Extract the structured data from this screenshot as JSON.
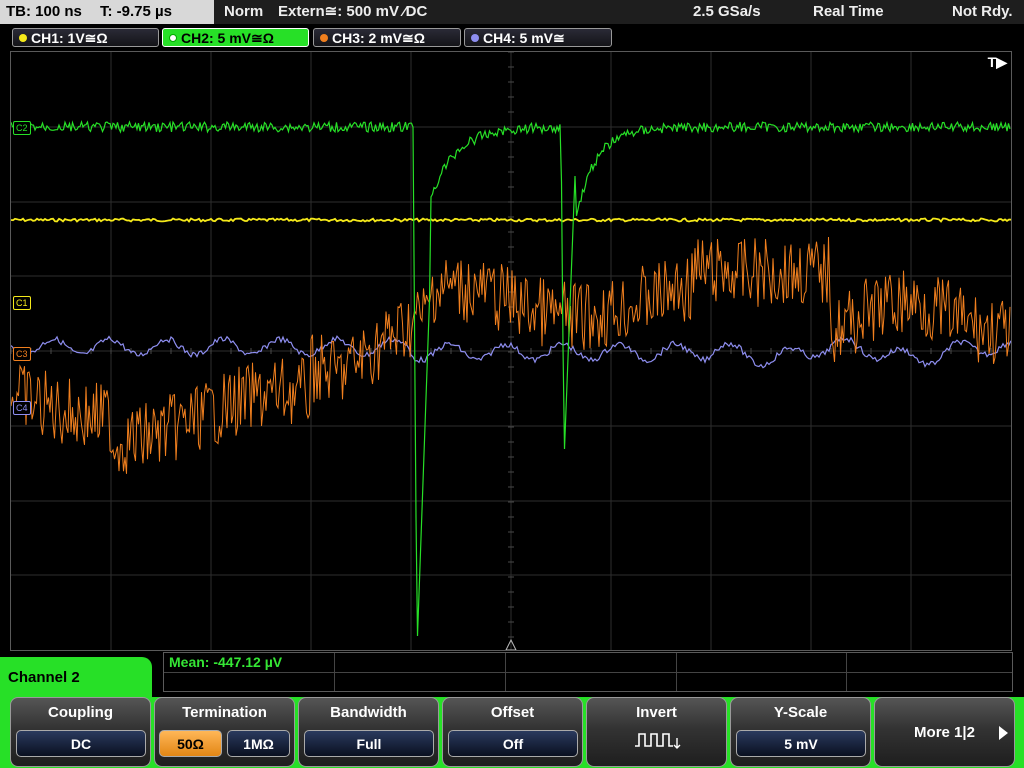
{
  "top": {
    "timebase": "TB: 100 ns",
    "trigger_time": "T: -9.75 µs",
    "mode": "Norm",
    "trigger_source": "Extern≅: 500 mV ⁄DC",
    "sample_rate": "2.5 GSa/s",
    "acq_mode": "Real Time",
    "status": "Not Rdy."
  },
  "channels": [
    {
      "label": "CH1: 1V≅Ω",
      "color": "#f5e91a",
      "marker": "C1",
      "active": false
    },
    {
      "label": "CH2: 5 mV≅Ω",
      "color": "#27e027",
      "marker": "C2",
      "active": true
    },
    {
      "label": "CH3: 2 mV≅Ω",
      "color": "#f07f1e",
      "marker": "C3",
      "active": false
    },
    {
      "label": "CH4: 5 mV≅",
      "color": "#8e8ef0",
      "marker": "C4",
      "active": false
    }
  ],
  "trigger_marker": "T▶",
  "measure": {
    "mean": "Mean: -447.12 µV"
  },
  "menu": {
    "channel_title": "Channel 2",
    "coupling": {
      "title": "Coupling",
      "value": "DC"
    },
    "termination": {
      "title": "Termination",
      "opt1": "50Ω",
      "opt2": "1MΩ"
    },
    "bandwidth": {
      "title": "Bandwidth",
      "value": "Full"
    },
    "offset": {
      "title": "Offset",
      "value": "Off"
    },
    "invert": {
      "title": "Invert"
    },
    "yscale": {
      "title": "Y-Scale",
      "value": "5 mV"
    },
    "more": "More 1|2"
  }
}
